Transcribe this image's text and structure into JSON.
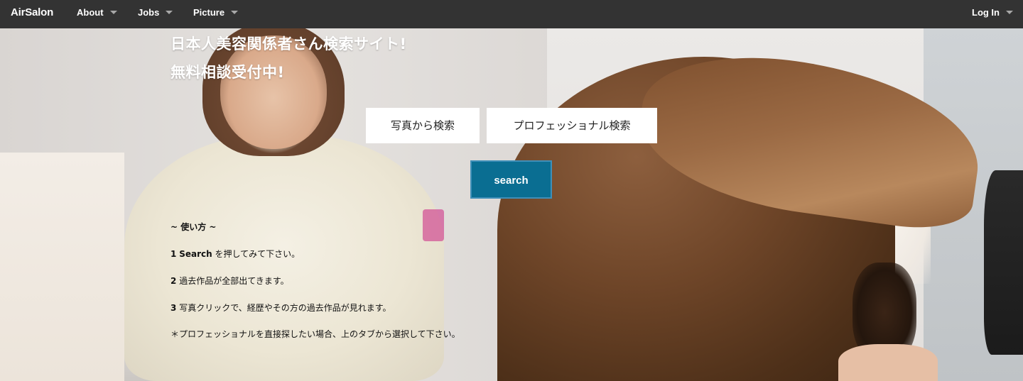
{
  "navbar": {
    "brand": "AirSalon",
    "items": [
      {
        "label": "About"
      },
      {
        "label": "Jobs"
      },
      {
        "label": "Picture"
      }
    ],
    "login": "Log In"
  },
  "hero": {
    "headline_line1": "日本人美容関係者さん検索サイト!",
    "headline_line2": "無料相談受付中!",
    "buttons": {
      "photo_search": "写真から検索",
      "professional_search": "プロフェッショナル検索",
      "search": "search"
    },
    "howto": {
      "title": "~ 使い方 ~",
      "steps": [
        {
          "num": "1",
          "bold": "Search",
          "text": " を押してみて下さい。"
        },
        {
          "num": "2",
          "bold": "",
          "text": "過去作品が全部出てきます。"
        },
        {
          "num": "3",
          "bold": "",
          "text": "写真クリックで、経歴やその方の過去作品が見れます。"
        }
      ],
      "note": "＊プロフェッショナルを直接探したい場合、上のタブから選択して下さい。"
    }
  }
}
